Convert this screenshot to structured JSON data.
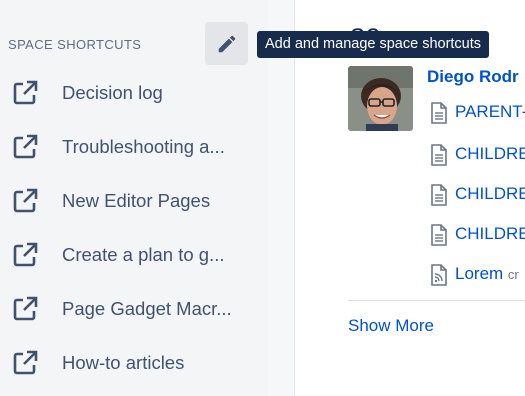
{
  "sidebar": {
    "section_title": "SPACE SHORTCUTS",
    "edit_tooltip": "Add and manage space shortcuts",
    "shortcuts": [
      {
        "label": "Decision log"
      },
      {
        "label": "Troubleshooting a..."
      },
      {
        "label": "New Editor Pages"
      },
      {
        "label": "Create a plan to g..."
      },
      {
        "label": "Page Gadget Macr..."
      },
      {
        "label": "How-to articles"
      }
    ]
  },
  "main": {
    "heading_fragment": "ac",
    "activity": {
      "user_name": "Diego Rodr",
      "pages": [
        {
          "title": "PARENT-",
          "icon": "page-icon"
        },
        {
          "title": "CHILDRE",
          "icon": "page-icon"
        },
        {
          "title": "CHILDRE",
          "icon": "page-icon"
        },
        {
          "title": "CHILDRE",
          "icon": "page-icon"
        },
        {
          "title": "Lorem",
          "suffix": "cr",
          "icon": "blog-icon"
        }
      ],
      "show_more": "Show More"
    }
  },
  "colors": {
    "link": "#0052cc",
    "sidebar_bg": "#f4f5f7",
    "tooltip_bg": "#172b4d",
    "icon": "#42526e"
  }
}
